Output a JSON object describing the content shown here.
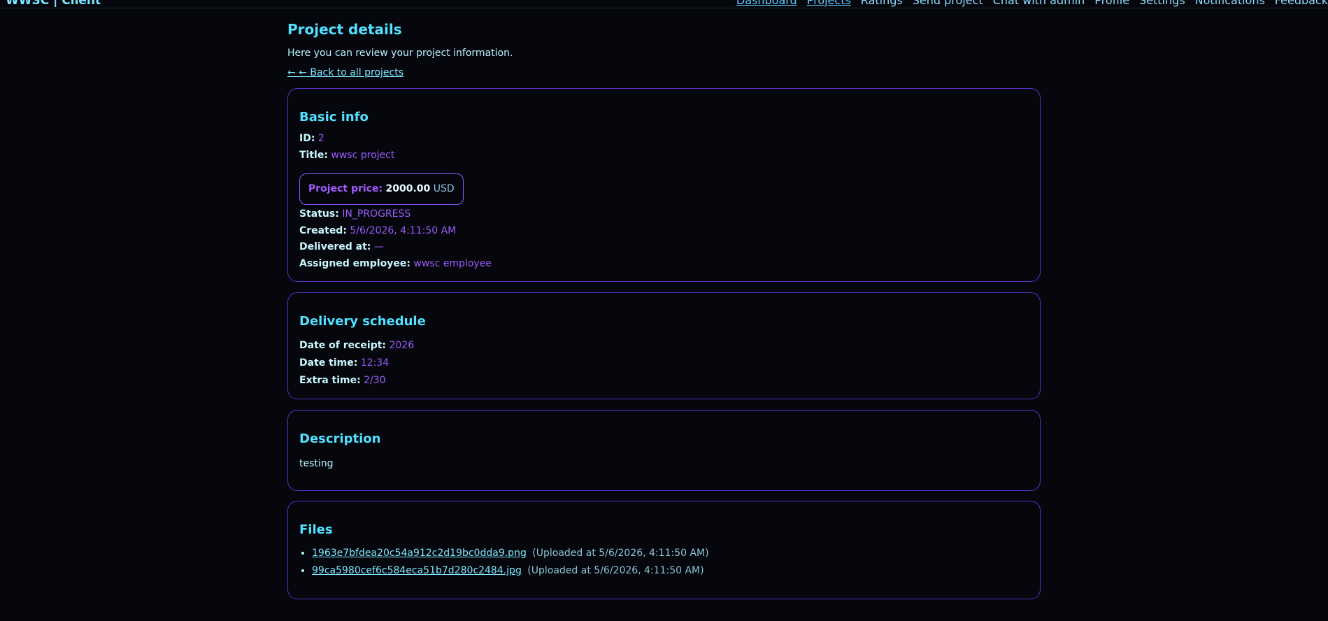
{
  "header": {
    "brand": "WWSC | Client",
    "nav": [
      "Dashboard",
      "Projects",
      "Ratings",
      "Send project",
      "Chat with admin",
      "Profile",
      "Settings",
      "Notifications",
      "Feedback"
    ]
  },
  "page": {
    "title": "Project details",
    "intro": "Here you can review your project information.",
    "back_link": "← ← Back to all projects"
  },
  "basic_info": {
    "heading": "Basic info",
    "id_label": "ID:",
    "id_value": "2",
    "title_label": "Title:",
    "title_value": "wwsc project",
    "price_label": "Project price:",
    "price_value": "2000.00",
    "price_currency": "USD",
    "status_label": "Status:",
    "status_value": "IN_PROGRESS",
    "created_label": "Created:",
    "created_value": "5/6/2026, 4:11:50 AM",
    "delivered_label": "Delivered at:",
    "delivered_value": "—",
    "employee_label": "Assigned employee:",
    "employee_value": "wwsc employee"
  },
  "schedule": {
    "heading": "Delivery schedule",
    "receipt_label": "Date of receipt:",
    "receipt_value": "2026",
    "time_label": "Date time:",
    "time_value": "12:34",
    "extra_label": "Extra time:",
    "extra_value": "2/30"
  },
  "description": {
    "heading": "Description",
    "text": "testing"
  },
  "files": {
    "heading": "Files",
    "items": [
      {
        "name": "1963e7bfdea20c54a912c2d19bc0dda9.png",
        "uploaded": "(Uploaded at 5/6/2026, 4:11:50 AM)"
      },
      {
        "name": "99ca5980cef6c584eca51b7d280c2484.jpg",
        "uploaded": "(Uploaded at 5/6/2026, 4:11:50 AM)"
      }
    ]
  },
  "colors": {
    "background": "#05070c",
    "accent_cyan": "#53e0ff",
    "accent_purple": "#9b5cff",
    "card_border": "#5a2fc6"
  }
}
